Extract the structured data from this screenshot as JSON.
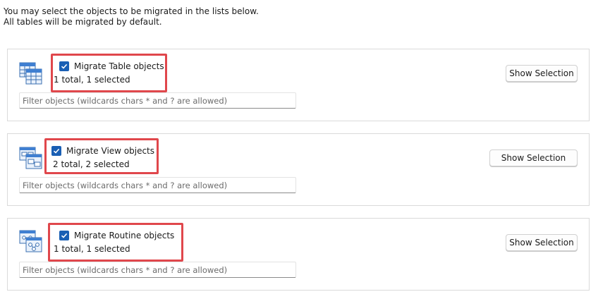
{
  "intro": {
    "line1": "You may select the objects to be migrated in the lists below.",
    "line2": "All tables will be migrated by default."
  },
  "colors": {
    "accent": "#1a5fb4",
    "highlight": "#e0474c"
  },
  "panels": [
    {
      "icon": "table-objects-icon",
      "checked": true,
      "title": "Migrate Table objects",
      "count": "1 total, 1 selected",
      "filter_placeholder": "Filter objects (wildcards chars * and ? are allowed)",
      "button": "Show Selection"
    },
    {
      "icon": "view-objects-icon",
      "checked": true,
      "title": "Migrate View objects",
      "count": "2 total, 2 selected",
      "filter_placeholder": "Filter objects (wildcards chars * and ? are allowed)",
      "button": "Show Selection"
    },
    {
      "icon": "routine-objects-icon",
      "checked": true,
      "title": "Migrate Routine objects",
      "count": "1 total, 1 selected",
      "filter_placeholder": "Filter objects (wildcards chars * and ? are allowed)",
      "button": "Show Selection"
    }
  ]
}
